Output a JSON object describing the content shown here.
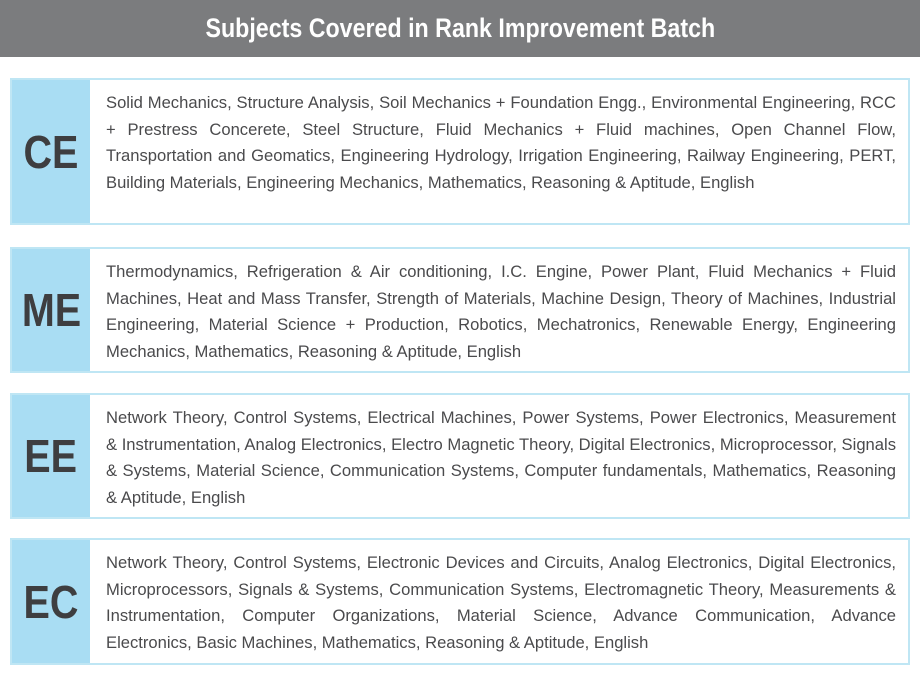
{
  "header": {
    "title": "Subjects Covered in Rank Improvement Batch",
    "background": "#7b7c7e"
  },
  "colors": {
    "code_cell": "#a9ddf3",
    "card_border": "#bfe6f4",
    "body_text": "#4a4a4c"
  },
  "branches": [
    {
      "code": "CE",
      "subjects": "Solid Mechanics, Structure Analysis, Soil Mechanics + Foundation Engg., Environmental Engineering, RCC + Prestress Concerete, Steel Structure, Fluid Mechanics + Fluid machines, Open Channel Flow, Transportation and Geomatics, Engineering Hydrology, Irrigation Engineering, Railway Engineering, PERT, Building Materials, Engineering Mechanics, Mathematics, Reasoning & Aptitude, English"
    },
    {
      "code": "ME",
      "subjects": "Thermodynamics, Refrigeration & Air conditioning, I.C. Engine, Power Plant, Fluid Mechanics + Fluid Machines, Heat and Mass Transfer, Strength of Materials, Machine Design, Theory of Machines, Industrial Engineering, Material Science + Production, Robotics, Mechatronics, Renewable Energy, Engineering Mechanics, Mathematics, Reasoning & Aptitude, English"
    },
    {
      "code": "EE",
      "subjects": "Network Theory, Control Systems, Electrical Machines, Power Systems, Power Electronics, Measurement & Instrumentation, Analog Electronics, Electro Magnetic Theory, Digital Electronics, Microprocessor, Signals & Systems, Material Science, Communication Systems, Computer fundamentals, Mathematics, Reasoning & Aptitude, English"
    },
    {
      "code": "EC",
      "subjects": "Network Theory, Control Systems, Electronic Devices and Circuits, Analog Electronics, Digital Electronics, Microprocessors, Signals & Systems, Communication Systems, Electromagnetic Theory, Measurements & Instrumentation, Computer Organizations, Material Science, Advance Communication, Advance Electronics, Basic Machines, Mathematics, Reasoning & Aptitude, English"
    }
  ]
}
